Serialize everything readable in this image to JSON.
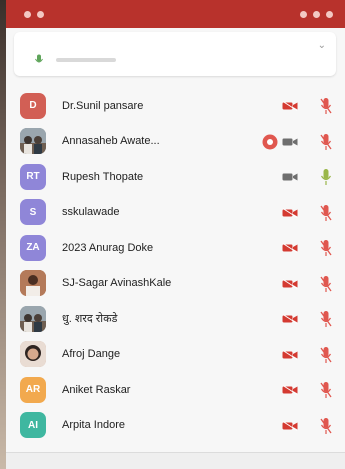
{
  "colors": {
    "status_bar": "#b8322c",
    "muted_mic": "#e0574f",
    "video_off": "#d43a31",
    "active_mic": "#9ab74a",
    "avatar_red": "#d25f55",
    "avatar_purple": "#8f86d8",
    "avatar_orange": "#f2a94e",
    "avatar_green": "#3fb7a0"
  },
  "status_bar": {
    "left": "",
    "right": ""
  },
  "top_card": {
    "title": "",
    "subtitle": ""
  },
  "participants": [
    {
      "initials": "D",
      "name": "Dr.Sunil pansare",
      "tag": "",
      "avatar_type": "initials",
      "avatar_color": "#d25f55",
      "cam": "off",
      "mic": "muted",
      "recording": false
    },
    {
      "initials": "",
      "name": "Annasaheb Awate...",
      "tag": "",
      "avatar_type": "photo-group",
      "avatar_color": "#7b8a96",
      "cam": "off-gray",
      "mic": "muted",
      "recording": true
    },
    {
      "initials": "RT",
      "name": "Rupesh Thopate",
      "tag": "",
      "avatar_type": "initials",
      "avatar_color": "#8f86d8",
      "cam": "off-gray",
      "mic": "active",
      "recording": false
    },
    {
      "initials": "S",
      "name": "sskulawade",
      "tag": "",
      "avatar_type": "initials",
      "avatar_color": "#8f86d8",
      "cam": "off",
      "mic": "muted",
      "recording": false
    },
    {
      "initials": "ZA",
      "name": "2023 Anurag Doke",
      "tag": "",
      "avatar_type": "initials",
      "avatar_color": "#8f86d8",
      "cam": "off",
      "mic": "muted",
      "recording": false
    },
    {
      "initials": "",
      "name": "SJ-Sagar AvinashKale",
      "tag": "",
      "avatar_type": "photo-person",
      "avatar_color": "#a55c3d",
      "cam": "off",
      "mic": "muted",
      "recording": false
    },
    {
      "initials": "",
      "name": "धु. शरद रोकडे",
      "tag": "",
      "avatar_type": "photo-group",
      "avatar_color": "#8f9aa3",
      "cam": "off",
      "mic": "muted",
      "recording": false
    },
    {
      "initials": "",
      "name": "Afroj Dange",
      "tag": "",
      "avatar_type": "photo-face",
      "avatar_color": "#c9a38d",
      "cam": "off",
      "mic": "muted",
      "recording": false
    },
    {
      "initials": "AR",
      "name": "Aniket Raskar",
      "tag": "",
      "avatar_type": "initials",
      "avatar_color": "#f2a94e",
      "cam": "off",
      "mic": "muted",
      "recording": false
    },
    {
      "initials": "AI",
      "name": "Arpita Indore",
      "tag": "",
      "avatar_type": "initials",
      "avatar_color": "#3fb7a0",
      "cam": "off",
      "mic": "muted",
      "recording": false
    }
  ],
  "bottom_bar": {
    "label": ""
  }
}
